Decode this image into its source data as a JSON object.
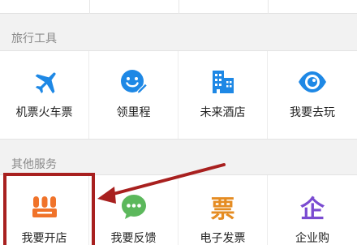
{
  "sections": {
    "tools": {
      "title": "旅行工具",
      "items": [
        {
          "label": "机票火车票",
          "icon": "airplane-icon"
        },
        {
          "label": "领里程",
          "icon": "smile-pencil-icon"
        },
        {
          "label": "未来酒店",
          "icon": "hotel-building-icon"
        },
        {
          "label": "我要去玩",
          "icon": "eye-icon"
        }
      ]
    },
    "services": {
      "title": "其他服务",
      "items": [
        {
          "label": "我要开店",
          "icon": "shop-icon",
          "glyph": ""
        },
        {
          "label": "我要反馈",
          "icon": "chat-bubble-icon",
          "glyph": ""
        },
        {
          "label": "电子发票",
          "icon": "invoice-icon",
          "glyph": "票"
        },
        {
          "label": "企业购",
          "icon": "enterprise-icon",
          "glyph": "企"
        }
      ]
    }
  },
  "colors": {
    "tool_blue": "#1e88e5",
    "shop_orange": "#f0732a",
    "feedback_green": "#5cb85c",
    "invoice_orange": "#e58c22",
    "enterprise_purple": "#7a4bd1",
    "annotation_red": "#a8201f"
  }
}
